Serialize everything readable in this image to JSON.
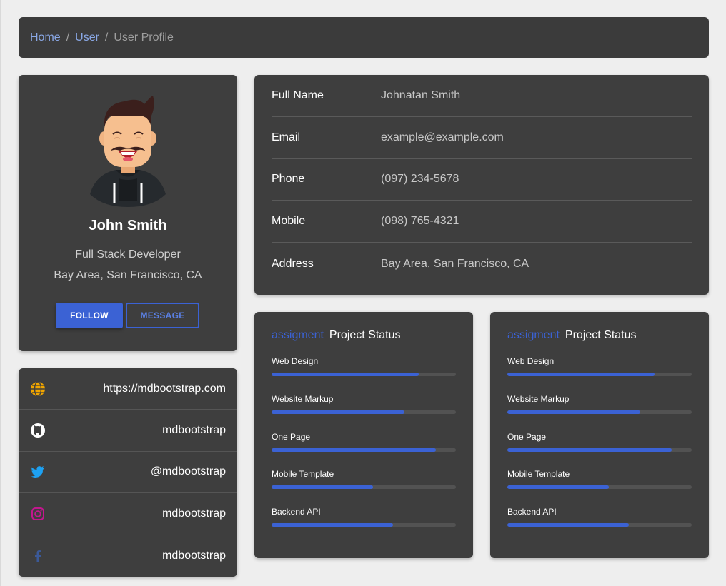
{
  "breadcrumb": {
    "home": "Home",
    "user": "User",
    "current": "User Profile"
  },
  "profile": {
    "name": "John Smith",
    "role": "Full Stack Developer",
    "location": "Bay Area, San Francisco, CA",
    "follow_label": "FOLLOW",
    "message_label": "MESSAGE"
  },
  "social": [
    {
      "icon": "globe-icon",
      "value": "https://mdbootstrap.com",
      "color": "#f0a500"
    },
    {
      "icon": "github-icon",
      "value": "mdbootstrap",
      "color": "#ffffff"
    },
    {
      "icon": "twitter-icon",
      "value": "@mdbootstrap",
      "color": "#1da1f2"
    },
    {
      "icon": "instagram-icon",
      "value": "mdbootstrap",
      "color": "#c2178e"
    },
    {
      "icon": "facebook-icon",
      "value": "mdbootstrap",
      "color": "#3b5998"
    }
  ],
  "info": [
    {
      "label": "Full Name",
      "value": "Johnatan Smith"
    },
    {
      "label": "Email",
      "value": "example@example.com"
    },
    {
      "label": "Phone",
      "value": "(097) 234-5678"
    },
    {
      "label": "Mobile",
      "value": "(098) 765-4321"
    },
    {
      "label": "Address",
      "value": "Bay Area, San Francisco, CA"
    }
  ],
  "projects": [
    {
      "accent": "assigment",
      "title": "Project Status",
      "items": [
        {
          "label": "Web Design",
          "percent": 80
        },
        {
          "label": "Website Markup",
          "percent": 72
        },
        {
          "label": "One Page",
          "percent": 89
        },
        {
          "label": "Mobile Template",
          "percent": 55
        },
        {
          "label": "Backend API",
          "percent": 66
        }
      ]
    },
    {
      "accent": "assigment",
      "title": "Project Status",
      "items": [
        {
          "label": "Web Design",
          "percent": 80
        },
        {
          "label": "Website Markup",
          "percent": 72
        },
        {
          "label": "One Page",
          "percent": 89
        },
        {
          "label": "Mobile Template",
          "percent": 55
        },
        {
          "label": "Backend API",
          "percent": 66
        }
      ]
    }
  ],
  "colors": {
    "accent": "#3b62d4",
    "card": "#3e3e3e",
    "background": "#eeeeee"
  }
}
